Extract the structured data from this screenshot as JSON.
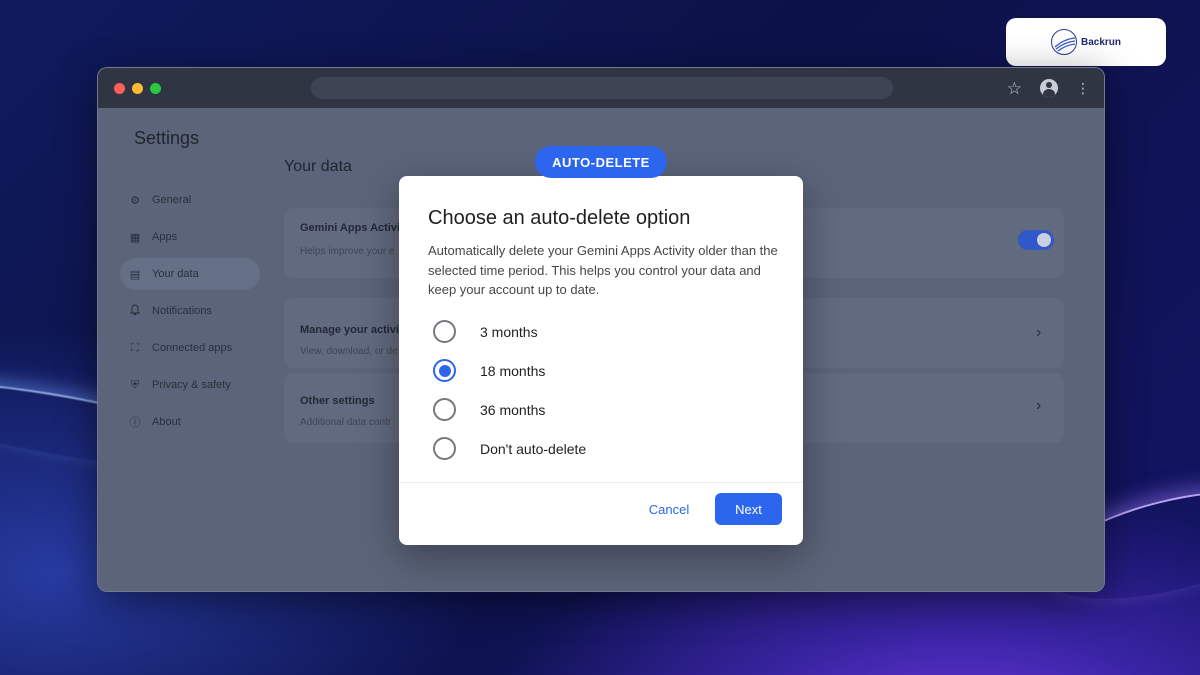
{
  "brand": {
    "name": "Backrun"
  },
  "window": {
    "toolbar_icons": [
      "star-icon",
      "account-icon",
      "more-vert-icon"
    ]
  },
  "settings": {
    "title": "Settings",
    "sidebar": [
      {
        "label": "General",
        "icon": "gear-icon",
        "glyph": "⚙"
      },
      {
        "label": "Apps",
        "icon": "apps-icon",
        "glyph": "▦"
      },
      {
        "label": "Your data",
        "icon": "document-icon",
        "glyph": "▤",
        "active": true
      },
      {
        "label": "Notifications",
        "icon": "bell-icon",
        "glyph": "🔔"
      },
      {
        "label": "Connected apps",
        "icon": "connected-apps-icon",
        "glyph": "⛶"
      },
      {
        "label": "Privacy & safety",
        "icon": "shield-icon",
        "glyph": "⛨"
      },
      {
        "label": "About",
        "icon": "info-icon",
        "glyph": "ⓘ"
      }
    ],
    "section_title": "Your data",
    "cards": [
      {
        "title": "Gemini Apps Activi",
        "subtitle": "Helps improve your e",
        "toggle_on": true
      },
      {
        "title": "Manage your activit",
        "subtitle": "View, download, or de"
      },
      {
        "title": "Other settings",
        "subtitle": "Additional data contr"
      }
    ]
  },
  "badge": {
    "label": "AUTO-DELETE"
  },
  "dialog": {
    "title": "Choose an auto-delete option",
    "description": "Automatically delete your Gemini Apps Activity older than the selected time period. This helps you control your data and keep your account up to date.",
    "options": [
      {
        "label": "3 months",
        "selected": false
      },
      {
        "label": "18 months",
        "selected": true
      },
      {
        "label": "36 months",
        "selected": false
      },
      {
        "label": "Don't auto-delete",
        "selected": false
      }
    ],
    "cancel_label": "Cancel",
    "next_label": "Next"
  },
  "colors": {
    "accent": "#2c66ee",
    "titlebar": "#2f3543",
    "overlay_bg": "#5b6479"
  }
}
